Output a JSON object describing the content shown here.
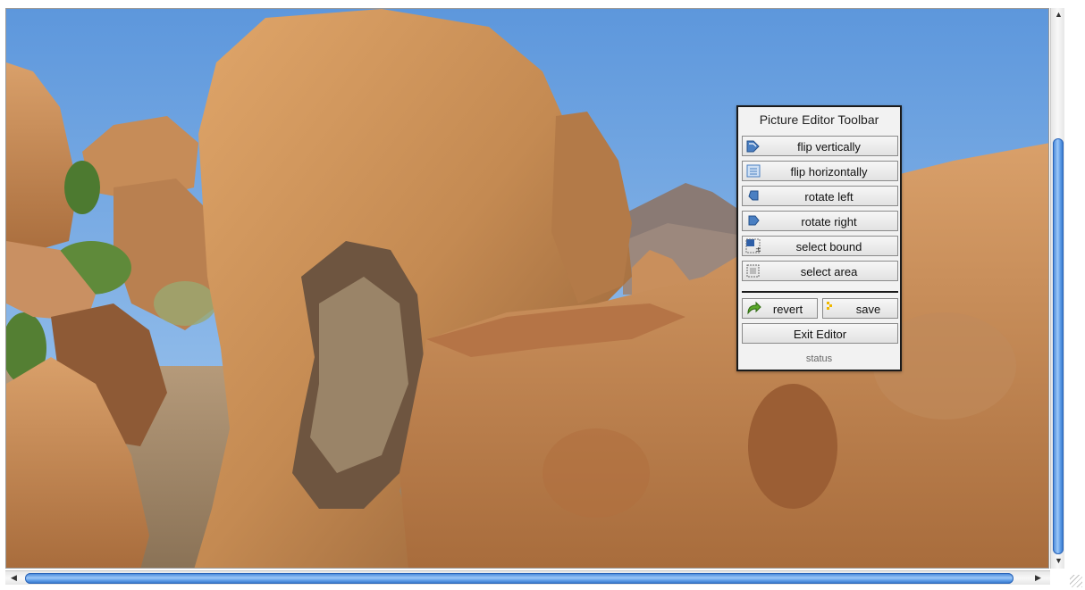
{
  "toolbar": {
    "title": "Picture Editor Toolbar",
    "buttons": {
      "flip_vertically": "flip vertically",
      "flip_horizontally": "flip horizontally",
      "rotate_left": "rotate left",
      "rotate_right": "rotate right",
      "select_bound": "select bound",
      "select_area": "select area",
      "revert": "revert",
      "save": "save",
      "exit": "Exit Editor"
    },
    "status": "status"
  },
  "icons": [
    "flip-vertical-icon",
    "flip-horizontal-icon",
    "rotate-left-icon",
    "rotate-right-icon",
    "select-bound-icon",
    "select-area-icon",
    "revert-arrow-icon",
    "save-icon"
  ],
  "colors": {
    "scroll_thumb": "#5d9ce8",
    "sky": "#7fb4e8",
    "rock": "#c98f55"
  }
}
